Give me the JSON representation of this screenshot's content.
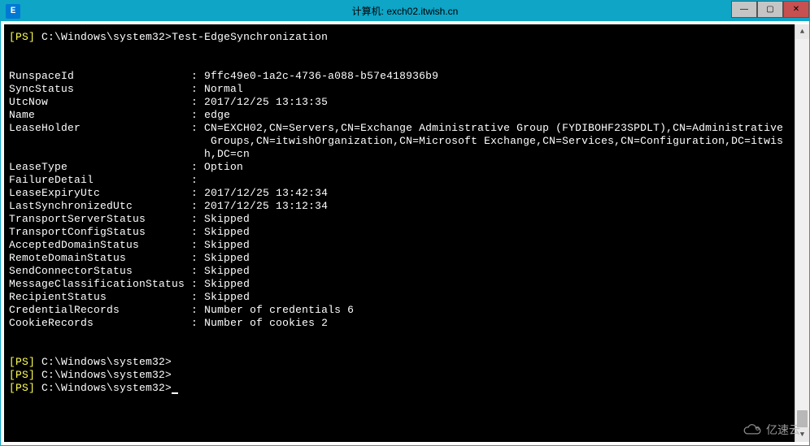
{
  "window": {
    "title_prefix": "计算机: ",
    "hostname": "exch02.itwish.cn"
  },
  "terminal": {
    "prompt_tag": "[PS]",
    "prompt_path": "C:\\Windows\\system32>",
    "command": "Test-EdgeSynchronization",
    "fields": {
      "RunspaceId": "9ffc49e0-1a2c-4736-a088-b57e418936b9",
      "SyncStatus": "Normal",
      "UtcNow": "2017/12/25 13:13:35",
      "Name": "edge",
      "LeaseHolder": "CN=EXCH02,CN=Servers,CN=Exchange Administrative Group (FYDIBOHF23SPDLT),CN=Administrative",
      "LeaseHolder_cont1": "Groups,CN=itwishOrganization,CN=Microsoft Exchange,CN=Services,CN=Configuration,DC=itwis",
      "LeaseHolder_cont2": "h,DC=cn",
      "LeaseType": "Option",
      "FailureDetail": "",
      "LeaseExpiryUtc": "2017/12/25 13:42:34",
      "LastSynchronizedUtc": "2017/12/25 13:12:34",
      "TransportServerStatus": "Skipped",
      "TransportConfigStatus": "Skipped",
      "AcceptedDomainStatus": "Skipped",
      "RemoteDomainStatus": "Skipped",
      "SendConnectorStatus": "Skipped",
      "MessageClassificationStatus": "Skipped",
      "RecipientStatus": "Skipped",
      "CredentialRecords": "Number of credentials 6",
      "CookieRecords": "Number of cookies 2"
    },
    "labels": {
      "RunspaceId": "RunspaceId",
      "SyncStatus": "SyncStatus",
      "UtcNow": "UtcNow",
      "Name": "Name",
      "LeaseHolder": "LeaseHolder",
      "LeaseType": "LeaseType",
      "FailureDetail": "FailureDetail",
      "LeaseExpiryUtc": "LeaseExpiryUtc",
      "LastSynchronizedUtc": "LastSynchronizedUtc",
      "TransportServerStatus": "TransportServerStatus",
      "TransportConfigStatus": "TransportConfigStatus",
      "AcceptedDomainStatus": "AcceptedDomainStatus",
      "RemoteDomainStatus": "RemoteDomainStatus",
      "SendConnectorStatus": "SendConnectorStatus",
      "MessageClassificationStatus": "MessageClassificationStatus",
      "RecipientStatus": "RecipientStatus",
      "CredentialRecords": "CredentialRecords",
      "CookieRecords": "CookieRecords"
    }
  },
  "watermark": "亿速云"
}
